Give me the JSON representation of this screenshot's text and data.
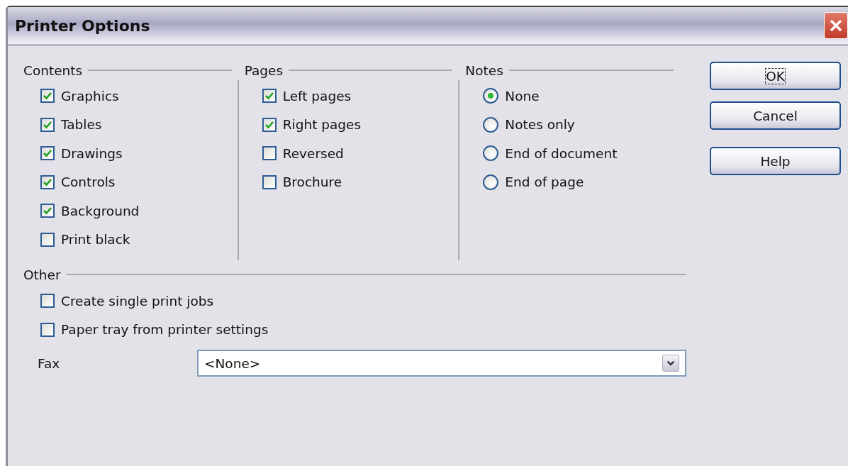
{
  "window": {
    "title": "Printer Options"
  },
  "groups": [
    {
      "title": "Contents",
      "items": [
        {
          "kind": "checkbox",
          "label": "Graphics",
          "checked": true
        },
        {
          "kind": "checkbox",
          "label": "Tables",
          "checked": true
        },
        {
          "kind": "checkbox",
          "label": "Drawings",
          "checked": true
        },
        {
          "kind": "checkbox",
          "label": "Controls",
          "checked": true
        },
        {
          "kind": "checkbox",
          "label": "Background",
          "checked": true
        },
        {
          "kind": "checkbox",
          "label": "Print black",
          "checked": false
        }
      ]
    },
    {
      "title": "Pages",
      "items": [
        {
          "kind": "checkbox",
          "label": "Left pages",
          "checked": true
        },
        {
          "kind": "checkbox",
          "label": "Right pages",
          "checked": true
        },
        {
          "kind": "checkbox",
          "label": "Reversed",
          "checked": false
        },
        {
          "kind": "checkbox",
          "label": "Brochure",
          "checked": false
        }
      ]
    },
    {
      "title": "Notes",
      "items": [
        {
          "kind": "radio",
          "label": "None",
          "selected": true
        },
        {
          "kind": "radio",
          "label": "Notes only",
          "selected": false
        },
        {
          "kind": "radio",
          "label": "End of document",
          "selected": false
        },
        {
          "kind": "radio",
          "label": "End of page",
          "selected": false
        }
      ]
    }
  ],
  "other": {
    "title": "Other",
    "items": [
      {
        "label": "Create single print jobs",
        "checked": false
      },
      {
        "label": "Paper tray from printer settings",
        "checked": false
      }
    ],
    "fax": {
      "label": "Fax",
      "value": "<None>"
    }
  },
  "buttons": [
    {
      "label": "OK",
      "focused": true
    },
    {
      "label": "Cancel",
      "focused": false
    },
    {
      "label": "Help",
      "focused": false
    }
  ]
}
